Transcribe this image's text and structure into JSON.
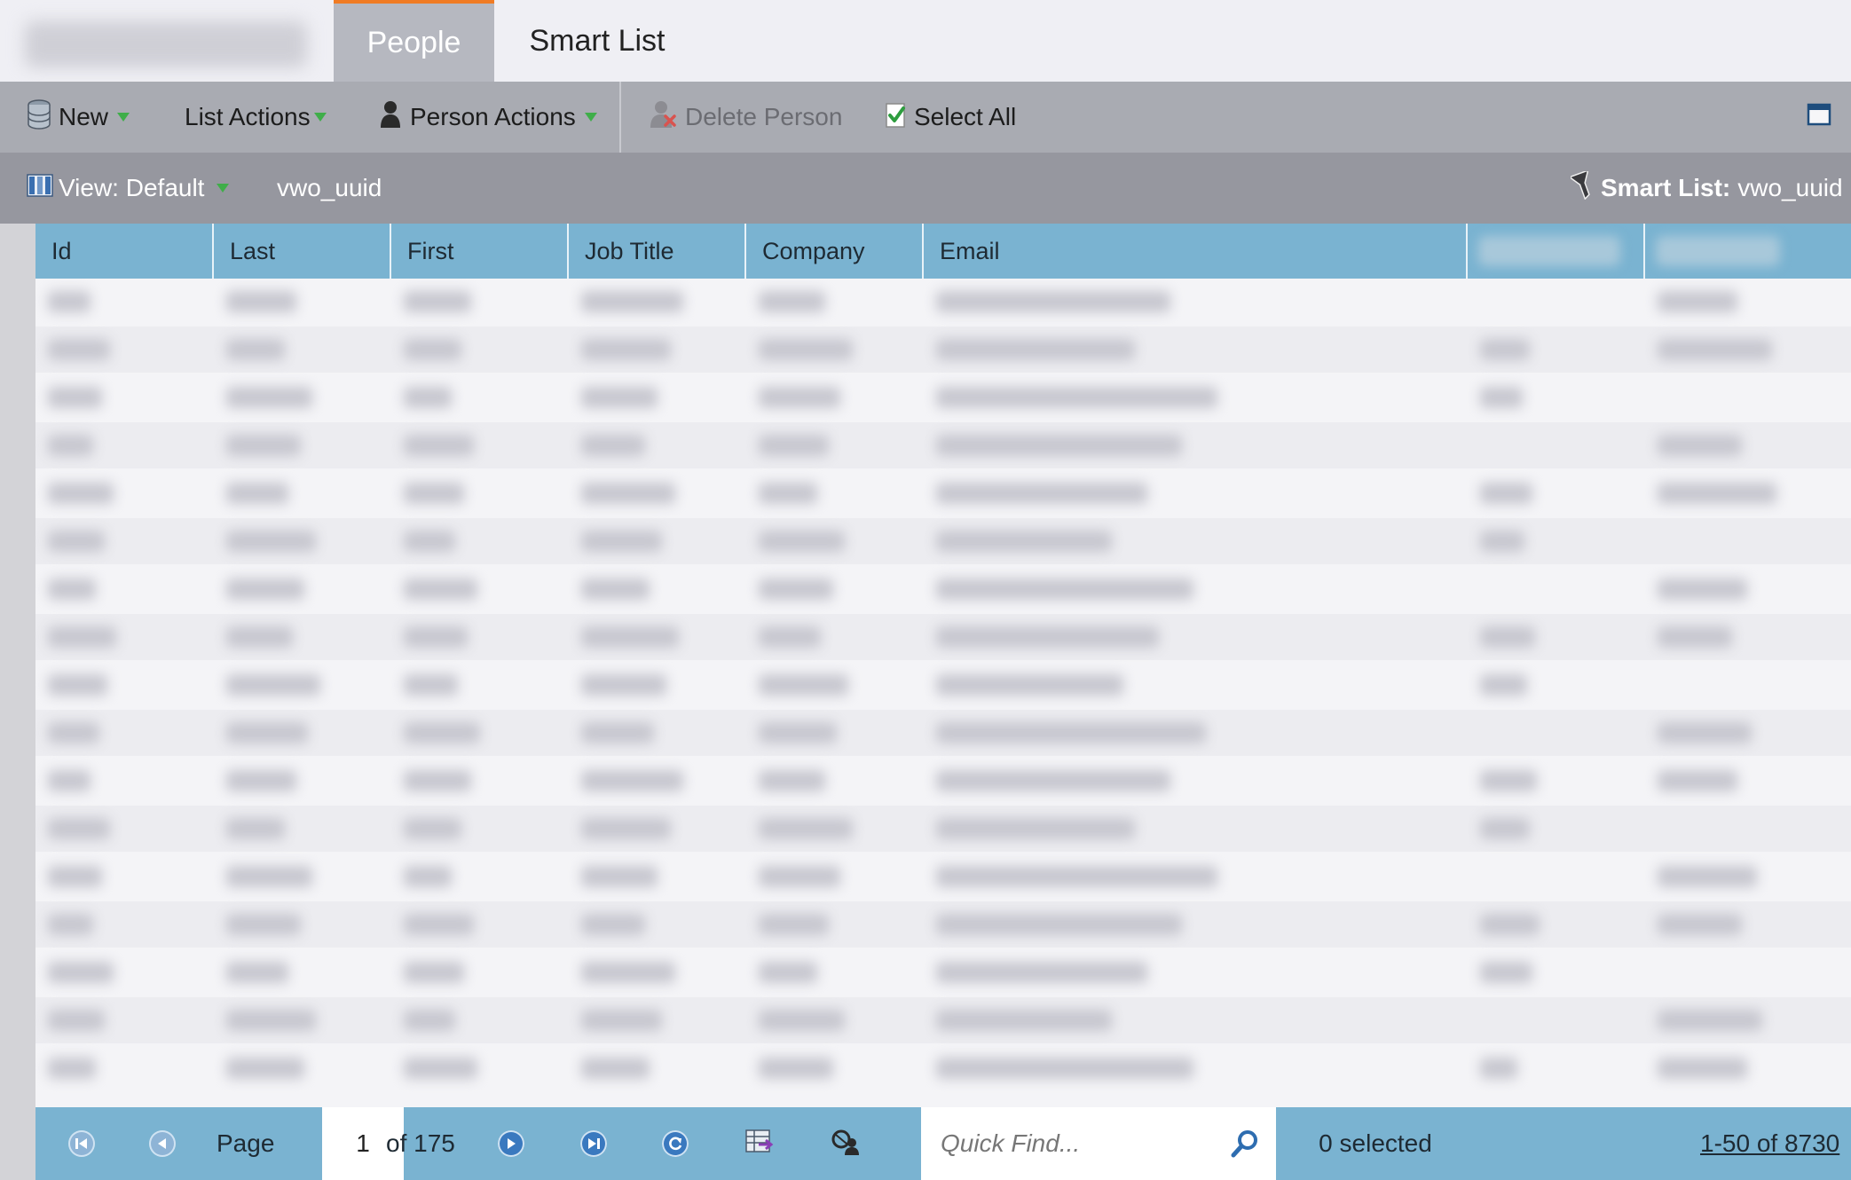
{
  "tabs": [
    {
      "label": "People",
      "active": true
    },
    {
      "label": "Smart List",
      "active": false
    }
  ],
  "toolbar": {
    "new_label": "New",
    "list_actions_label": "List Actions",
    "person_actions_label": "Person Actions",
    "delete_person_label": "Delete Person",
    "select_all_label": "Select All"
  },
  "viewbar": {
    "view_label": "View: Default",
    "list_name": "vwo_uuid",
    "smart_list_prefix": "Smart List:",
    "smart_list_name": "vwo_uuid"
  },
  "grid": {
    "columns": [
      "Id",
      "Last",
      "First",
      "Job Title",
      "Company",
      "Email"
    ]
  },
  "footer": {
    "page_label": "Page",
    "page_value": "1",
    "page_of": "of 175",
    "quick_find_placeholder": "Quick Find...",
    "selected_text": "0 selected",
    "range_text": "1-50 of 8730"
  },
  "colors": {
    "accent_tab": "#f07b24",
    "header_blue": "#7ab3d1",
    "caret_green": "#3fae49",
    "nav_button_blue": "#3a79bf"
  },
  "icons": {
    "new": "database-icon",
    "person": "person-icon",
    "delete": "delete-person-icon",
    "select_all": "checkbox-icon",
    "view": "columns-icon",
    "smart_list": "funnel-icon",
    "search": "search-icon",
    "maximize": "maximize-icon"
  }
}
